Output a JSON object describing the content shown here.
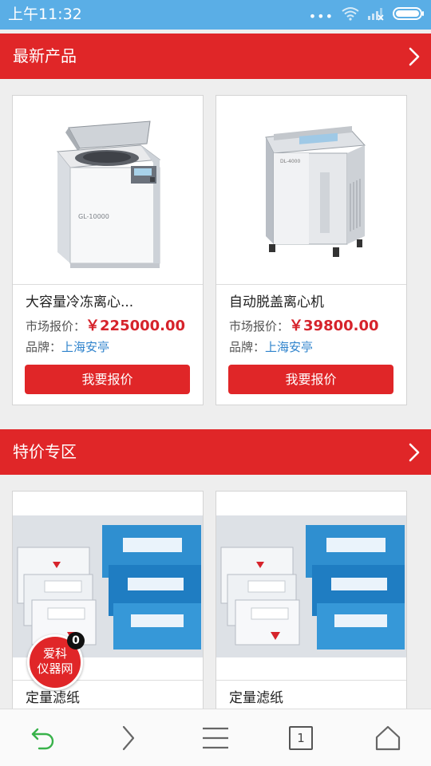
{
  "status_bar": {
    "time": "上午11:32",
    "dots": "•••"
  },
  "sections": [
    {
      "title": "最新产品"
    },
    {
      "title": "特价专区"
    }
  ],
  "products": [
    {
      "name": "大容量冷冻离心...",
      "price_label": "市场报价：",
      "price": "￥225000.00",
      "brand_label": "品牌：",
      "brand": "上海安亭",
      "button": "我要报价",
      "image": "centrifuge-open-lid"
    },
    {
      "name": "自动脱盖离心机",
      "price_label": "市场报价：",
      "price": "￥39800.00",
      "brand_label": "品牌：",
      "brand": "上海安亭",
      "button": "我要报价",
      "image": "centrifuge-floor"
    }
  ],
  "specials": [
    {
      "name": "定量滤纸",
      "image": "filter-paper-boxes"
    },
    {
      "name": "定量滤纸",
      "image": "filter-paper-boxes"
    }
  ],
  "floating_badge": {
    "line1": "爱科",
    "line2": "仪器网",
    "count": "0"
  },
  "bottom_nav": {
    "tab_count": "1"
  },
  "icons": [
    "wifi-icon",
    "signal-icon",
    "battery-icon",
    "chevron-right-icon",
    "back-icon",
    "forward-icon",
    "menu-icon",
    "tabs-icon",
    "home-icon"
  ],
  "colors": {
    "status_bar": "#5aaee6",
    "accent_red": "#e02628",
    "price_red": "#d6232b",
    "brand_blue": "#2f83cc",
    "back_green": "#38b24a"
  }
}
